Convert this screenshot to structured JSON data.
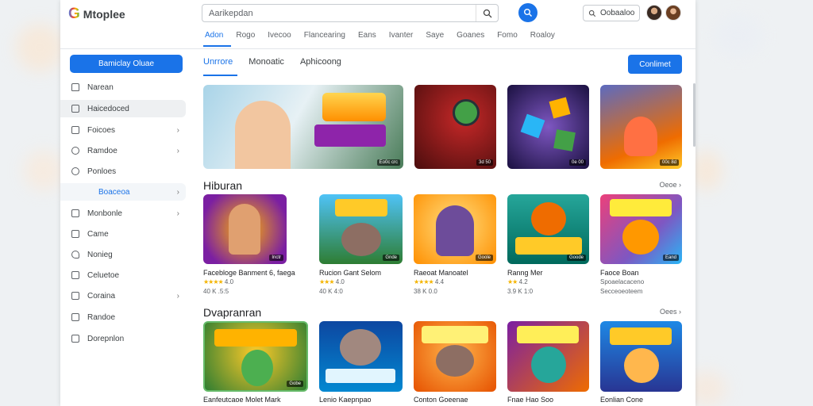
{
  "header": {
    "logo_letter": "G",
    "logo_text": "Mtoplee",
    "search_placeholder": "Aarikepdan",
    "signin_label": "Oobaaloo",
    "tabs": [
      "Adon",
      "Rogo",
      "Ivecoo",
      "Flancearing",
      "Eans",
      "Ivanter",
      "Saye",
      "Goanes",
      "Fomo",
      "Roaloy"
    ]
  },
  "sidebar": {
    "primary_button": "Bamiclay Oluae",
    "items": [
      {
        "label": "Narean",
        "chevron": false
      },
      {
        "label": "Haicedoced",
        "chevron": false
      },
      {
        "label": "Foicoes",
        "chevron": true
      },
      {
        "label": "Ramdoe",
        "chevron": true
      },
      {
        "label": "Ponloes",
        "chevron": false
      },
      {
        "label": "Boaceoa",
        "chevron": true
      },
      {
        "label": "Monbonle",
        "chevron": true
      },
      {
        "label": "Came",
        "chevron": false
      },
      {
        "label": "Nonieg",
        "chevron": false
      },
      {
        "label": "Celuetoe",
        "chevron": false
      },
      {
        "label": "Coraina",
        "chevron": true
      },
      {
        "label": "Randoe",
        "chevron": false
      },
      {
        "label": "Dorepnlon",
        "chevron": false
      }
    ]
  },
  "main": {
    "subtabs": [
      "Unrrore",
      "Monoatic",
      "Aphicoong"
    ],
    "cta_label": "Conlimet",
    "featured_badges": [
      "Eo0c crc",
      "3d 50",
      "0e 00",
      "00c 8d"
    ],
    "sections": [
      {
        "title": "Hiburan",
        "more": "Oeoe",
        "items": [
          {
            "name": "Facebloge Banment 6, faega",
            "rating": "★★★★ 4.0",
            "meta": "40 K .5:5",
            "badge": "Inctr"
          },
          {
            "name": "Rucion Gant Selom",
            "rating": "★★★ 4.0",
            "meta": "40 K 4:0",
            "badge": "Gnde"
          },
          {
            "name": "Raeoat Manoatel",
            "rating": "★★★★ 4.4",
            "meta": "38 K 0.0",
            "badge": "Goole"
          },
          {
            "name": "Ranng Mer",
            "rating": "★★ 4.2",
            "meta": "3.9 K 1:0",
            "badge": "Goode"
          },
          {
            "name": "Faoce Boan",
            "rating": "Spoaelacaceno",
            "meta": "Secceoeoteem",
            "badge": "Eand"
          }
        ]
      },
      {
        "title": "Dvapranran",
        "more": "Oees",
        "items": [
          {
            "name": "Eanfeutcaoe Molet Mark",
            "badge": "Gobe"
          },
          {
            "name": "Lenio Kaepnpao"
          },
          {
            "name": "Conton Goeenae"
          },
          {
            "name": "Fnae Hao Soo"
          },
          {
            "name": "Eonlian Cone"
          }
        ]
      }
    ]
  },
  "colors": {
    "accent": "#1a73e8",
    "star": "#f4b400"
  }
}
